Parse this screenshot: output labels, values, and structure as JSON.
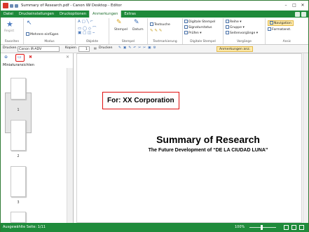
{
  "window": {
    "title": "Summary of Research.pdf - Canon iW Desktop - Editor",
    "min_glyph": "–",
    "max_glyph": "□",
    "close_glyph": "✕"
  },
  "tabs": [
    {
      "label": "Datei"
    },
    {
      "label": "Druckeinstellungen"
    },
    {
      "label": "Druckoptionen"
    },
    {
      "label": "Anmerkungen"
    },
    {
      "label": "Extras"
    }
  ],
  "ribbon": {
    "favoriten": {
      "label": "Favoriten",
      "regist": "Regist"
    },
    "modus": {
      "label": "Modus",
      "mehrere": "Mehrere einfügen"
    },
    "objekte": {
      "label": "Objekte"
    },
    "stempel": {
      "label": "Stempel",
      "stempel_btn": "Stempel",
      "datum_btn": "Datum"
    },
    "textmarkierung": {
      "label": "Textmarkierung",
      "textsuche": "Textsuche"
    },
    "digitale": {
      "label": "Digitale Stempel",
      "item1": "Digitale Stempel",
      "item2": "Signaturstatus",
      "item3": "Prüfen ▾"
    },
    "vorgaenge": {
      "label": "Vorgänge",
      "item1": "Reihe ▾",
      "item2": "Gruppe ▾",
      "item3": "Seitenvorgänge ▾"
    },
    "ansicht": {
      "label": "Ansic",
      "item1": "Navigation",
      "item2": "Formatanst."
    }
  },
  "toolbar": {
    "drucken_label": "Drucken",
    "printer": "Canon iR-ADV",
    "kopien_label": "Kopien",
    "kopien_value": "1",
    "drucken_button": "Drucken",
    "annotations_button": "Anmerkungen anz."
  },
  "sidebar": {
    "label": "Miniaturansichten",
    "pages": [
      "1",
      "2",
      "3"
    ]
  },
  "document": {
    "for_text": "For: XX Corporation",
    "title": "Summary of Research",
    "subtitle": "The Future Development of “DE LA CIUDAD LUNA”"
  },
  "statusbar": {
    "selected": "Ausgewählte Seite: 1/11",
    "zoom": "100%"
  }
}
